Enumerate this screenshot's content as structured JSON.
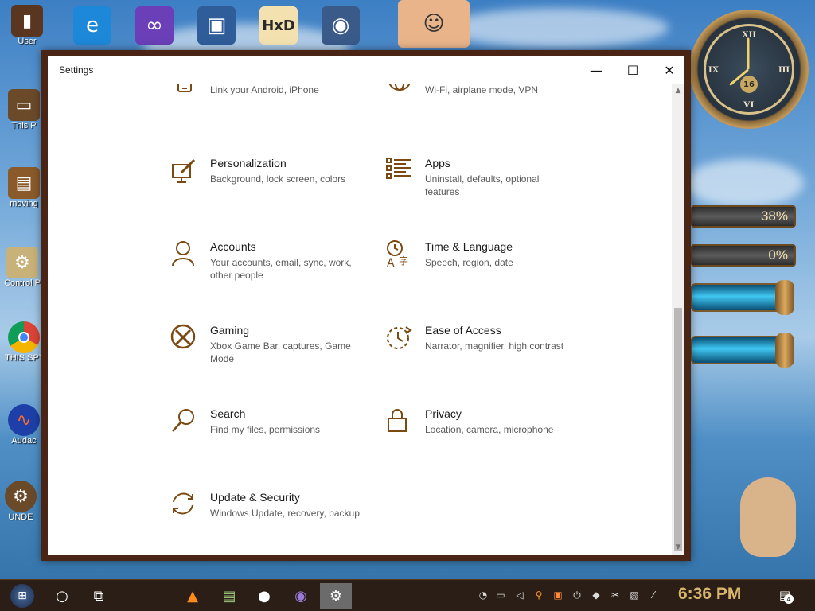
{
  "desktop": {
    "left_icons": [
      {
        "label": "User",
        "icon": "user-folder-icon"
      },
      {
        "label": "This P",
        "icon": "this-pc-icon"
      },
      {
        "label": "moving",
        "icon": "folder-icon"
      },
      {
        "label": "Control P",
        "icon": "control-panel-icon"
      },
      {
        "label": "THIS SPYWAR",
        "icon": "chrome-icon"
      },
      {
        "label": "Audac",
        "icon": "audacity-icon"
      },
      {
        "label": "UNDE",
        "icon": "folder-icon"
      }
    ],
    "top_icons": [
      "edge-icon",
      "visual-studio-icon",
      "virtualbox-icon",
      "hxd-icon",
      "spy-icon",
      "character-icon"
    ],
    "clock_gadget": {
      "numerals": [
        "XII",
        "III",
        "VI",
        "IX"
      ],
      "date": "16"
    },
    "gauges": [
      {
        "label": "38%"
      },
      {
        "label": "0%"
      }
    ]
  },
  "window": {
    "title": "Settings",
    "controls": {
      "minimize": "—",
      "maximize": "☐",
      "close": "✕"
    },
    "tiles": [
      {
        "key": "phone",
        "name": "",
        "desc": "Link your Android, iPhone"
      },
      {
        "key": "network",
        "name": "",
        "desc": "Wi-Fi, airplane mode, VPN"
      },
      {
        "key": "personalization",
        "name": "Personalization",
        "desc": "Background, lock screen, colors"
      },
      {
        "key": "apps",
        "name": "Apps",
        "desc": "Uninstall, defaults, optional features"
      },
      {
        "key": "accounts",
        "name": "Accounts",
        "desc": "Your accounts, email, sync, work, other people"
      },
      {
        "key": "time",
        "name": "Time & Language",
        "desc": "Speech, region, date"
      },
      {
        "key": "gaming",
        "name": "Gaming",
        "desc": "Xbox Game Bar, captures, Game Mode"
      },
      {
        "key": "ease",
        "name": "Ease of Access",
        "desc": "Narrator, magnifier, high contrast"
      },
      {
        "key": "search",
        "name": "Search",
        "desc": "Find my files, permissions"
      },
      {
        "key": "privacy",
        "name": "Privacy",
        "desc": "Location, camera, microphone"
      },
      {
        "key": "update",
        "name": "Update & Security",
        "desc": "Windows Update, recovery, backup"
      }
    ]
  },
  "taskbar": {
    "apps": [
      "start-icon",
      "cortana-icon",
      "task-view-icon",
      "vlc-icon",
      "terminal-icon",
      "cat-icon",
      "spy-icon",
      "settings-icon"
    ],
    "time": "6:36 PM",
    "notification_count": "4"
  },
  "colors": {
    "accent": "#7a4a12",
    "window_border": "#4a2414",
    "taskbar": "#2a1e16",
    "clock_text": "#d8b66a"
  }
}
